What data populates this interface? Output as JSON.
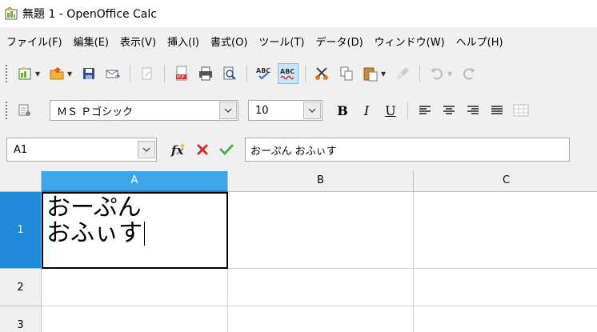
{
  "window": {
    "title": "無題 1 - OpenOffice Calc",
    "icon": "calc-app-icon"
  },
  "menu": [
    "ファイル(F)",
    "編集(E)",
    "表示(V)",
    "挿入(I)",
    "書式(O)",
    "ツール(T)",
    "データ(D)",
    "ウィンドウ(W)",
    "ヘルプ(H)"
  ],
  "standard_toolbar": {
    "icons": [
      "new-icon",
      "open-icon",
      "save-icon",
      "email-icon",
      "edit-file-icon",
      "export-pdf-icon",
      "print-icon",
      "print-preview-icon",
      "spellcheck-icon",
      "autospellcheck-icon",
      "cut-icon",
      "copy-icon",
      "paste-icon",
      "format-paintbrush-icon",
      "undo-icon",
      "redo-icon"
    ]
  },
  "format_toolbar": {
    "font_name": "ＭＳ Ｐゴシック",
    "font_size": "10",
    "bold_label": "B",
    "italic_label": "I",
    "underline_label": "U",
    "icons": [
      "styles-icon",
      "align-left-icon",
      "align-center-icon",
      "align-right-icon",
      "justify-icon",
      "merge-cells-icon"
    ]
  },
  "formula_bar": {
    "name_box": "A1",
    "content": "おーぷん おふぃす",
    "icons": [
      "function-wizard-icon",
      "cancel-icon",
      "accept-icon"
    ]
  },
  "sheet": {
    "columns": [
      "A",
      "B",
      "C"
    ],
    "rows": [
      "1",
      "2",
      "3"
    ],
    "active_cell": "A1",
    "cell_a1_line1": "おーぷん",
    "cell_a1_line2": "おふぃす"
  },
  "colors": {
    "selection_header": "#3da6e8",
    "selected_row_header": "#1f8ad9",
    "active_toggle": "#cde3f7"
  }
}
